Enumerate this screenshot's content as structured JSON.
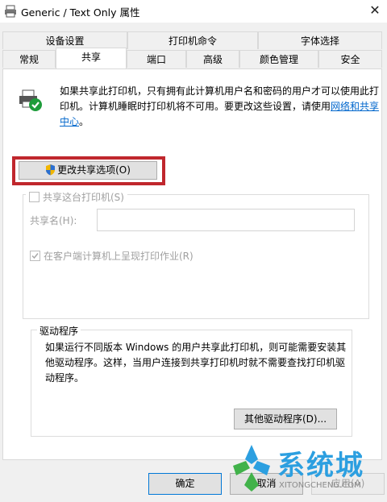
{
  "window": {
    "title": "Generic / Text Only 属性",
    "close_glyph": "✕"
  },
  "tabs_row_top": [
    "设备设置",
    "打印机命令",
    "字体选择"
  ],
  "tabs_row_bottom": [
    "常规",
    "共享",
    "端口",
    "高级",
    "颜色管理",
    "安全"
  ],
  "active_tab": "共享",
  "intro": {
    "text": "如果共享此打印机，只有拥有此计算机用户名和密码的用户才可以使用此打印机。计算机睡眠时打印机将不可用。要更改这些设置，请使用",
    "link": "网络和共享中心",
    "suffix": "。"
  },
  "change_sharing_button": "更改共享选项(O)",
  "share_printer_checkbox": {
    "label": "共享这台打印机(S)",
    "checked": false,
    "disabled": true
  },
  "share_name": {
    "label": "共享名(H):",
    "value": ""
  },
  "render_jobs_checkbox": {
    "label": "在客户端计算机上呈现打印作业(R)",
    "checked": true,
    "disabled": true
  },
  "drivers": {
    "legend": "驱动程序",
    "text": "如果运行不同版本 Windows 的用户共享此打印机，则可能需要安装其他驱动程序。这样，当用户连接到共享打印机时就不需要查找打印机驱动程序。",
    "button": "其他驱动程序(D)..."
  },
  "footer": {
    "ok": "确定",
    "cancel": "取消",
    "apply": "应用(A)"
  },
  "watermark": {
    "text": "系统城",
    "sub": "XITONGCHENG.COM"
  },
  "colors": {
    "highlight": "#c0272d",
    "link": "#0066cc",
    "watermark": "#2c9fe0"
  },
  "icons": [
    "printer-icon",
    "shared-printer-icon",
    "uac-shield-icon",
    "close-icon",
    "check-icon"
  ]
}
